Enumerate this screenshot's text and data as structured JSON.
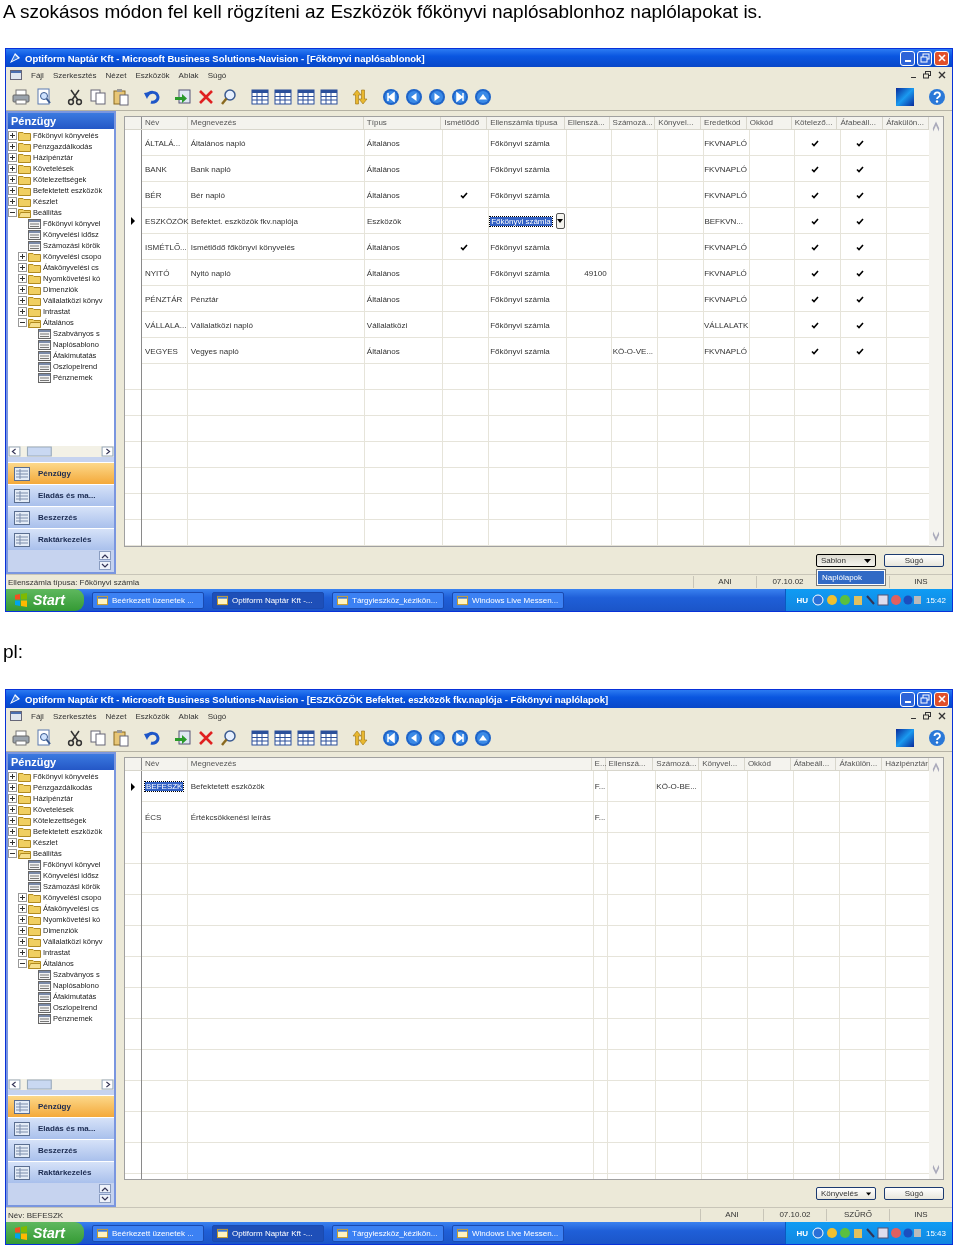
{
  "blocks": [
    {
      "kind": "text",
      "text": "A szokásos módon fel kell rögzíteni az Eszközök főkönyvi naplósablonhoz naplólapokat is."
    },
    {
      "kind": "screen",
      "window_title": "Optiform Naptár Kft - Microsoft Business Solutions-Navision - [Főkönyvi naplósablonok]",
      "menu": [
        "Fájl",
        "Szerkesztés",
        "Nézet",
        "Eszközök",
        "Ablak",
        "Súgó"
      ],
      "sidebar": {
        "title": "Pénzügy",
        "tree": [
          {
            "label": "Főkönyvi könyvelés",
            "kind": "folder",
            "expanded": false
          },
          {
            "label": "Pénzgazdálkodás",
            "kind": "folder",
            "expanded": false
          },
          {
            "label": "Házipénztár",
            "kind": "folder",
            "expanded": false
          },
          {
            "label": "Követelések",
            "kind": "folder",
            "expanded": false
          },
          {
            "label": "Kötelezettségek",
            "kind": "folder",
            "expanded": false
          },
          {
            "label": "Befektetett eszközök",
            "kind": "folder",
            "expanded": false
          },
          {
            "label": "Készlet",
            "kind": "folder",
            "expanded": false
          },
          {
            "label": "Beállítás",
            "kind": "folder",
            "expanded": true,
            "children": [
              {
                "label": "Főkönyvi könyvel",
                "kind": "form"
              },
              {
                "label": "Könyvelési idősz",
                "kind": "form"
              },
              {
                "label": "Számozási körök",
                "kind": "form"
              },
              {
                "label": "Könyvelési csopo",
                "kind": "folder",
                "expanded": false
              },
              {
                "label": "Áfakönyvelési cs",
                "kind": "folder",
                "expanded": false
              },
              {
                "label": "Nyomkövetési kó",
                "kind": "folder",
                "expanded": false
              },
              {
                "label": "Dimenziók",
                "kind": "folder",
                "expanded": false
              },
              {
                "label": "Vállalatközi könyv",
                "kind": "folder",
                "expanded": false
              },
              {
                "label": "Intrastat",
                "kind": "folder",
                "expanded": false
              },
              {
                "label": "Általános",
                "kind": "folder",
                "expanded": true,
                "children": [
                  {
                    "label": "Szabványos s",
                    "kind": "form"
                  },
                  {
                    "label": "Naplósablono",
                    "kind": "form"
                  },
                  {
                    "label": "Áfakimutatás",
                    "kind": "form"
                  },
                  {
                    "label": "Oszlopelrend",
                    "kind": "form"
                  },
                  {
                    "label": "Pénznemek",
                    "kind": "form"
                  }
                ]
              }
            ]
          }
        ],
        "nav_buttons": [
          {
            "label": "Pénzügy",
            "selected": true
          },
          {
            "label": "Eladás és ma...",
            "selected": false
          },
          {
            "label": "Beszerzés",
            "selected": false
          },
          {
            "label": "Raktárkezelés",
            "selected": false
          }
        ]
      },
      "grid": {
        "columns": [
          {
            "label": "Név",
            "kind": "text"
          },
          {
            "label": "Megnevezés",
            "kind": "text"
          },
          {
            "label": "Típus",
            "kind": "text"
          },
          {
            "label": "Ismétlődő",
            "kind": "check"
          },
          {
            "label": "Ellenszámla típusa",
            "kind": "text"
          },
          {
            "label": "Ellenszá...",
            "kind": "number"
          },
          {
            "label": "Számozá...",
            "kind": "text"
          },
          {
            "label": "Könyvel...",
            "kind": "text"
          },
          {
            "label": "Eredetkód",
            "kind": "text"
          },
          {
            "label": "Okkód",
            "kind": "text"
          },
          {
            "label": "Kötelező...",
            "kind": "check"
          },
          {
            "label": "Áfabeáll...",
            "kind": "check"
          },
          {
            "label": "Áfakülön...",
            "kind": "text"
          }
        ],
        "rows": [
          {
            "selected": false,
            "cells": [
              "ÁLTALÁ...",
              "Általános napló",
              "Általános",
              false,
              "Főkönyvi számla",
              null,
              null,
              null,
              "FKVNAPLÓ",
              null,
              true,
              true,
              null
            ]
          },
          {
            "selected": false,
            "cells": [
              "BANK",
              "Bank napló",
              "Általános",
              false,
              "Főkönyvi számla",
              null,
              null,
              null,
              "FKVNAPLÓ",
              null,
              true,
              true,
              null
            ]
          },
          {
            "selected": false,
            "cells": [
              "BÉR",
              "Bér napló",
              "Általános",
              true,
              "Főkönyvi számla",
              null,
              null,
              null,
              "FKVNAPLÓ",
              null,
              true,
              true,
              null
            ]
          },
          {
            "selected": true,
            "cells": [
              "ESZKÖZÖK",
              "Befektet. eszközök fkv.naplója",
              "Eszközök",
              false,
              {
                "text": "Főkönyvi számla",
                "selected": true,
                "dropdown": true
              },
              null,
              null,
              null,
              "BEFKVN...",
              null,
              true,
              true,
              null
            ]
          },
          {
            "selected": false,
            "cells": [
              "ISMÉTLŐ...",
              "Ismétlődő főkönyvi könyvelés",
              "Általános",
              true,
              "Főkönyvi számla",
              null,
              null,
              null,
              "FKVNAPLÓ",
              null,
              true,
              true,
              null
            ]
          },
          {
            "selected": false,
            "cells": [
              "NYITÓ",
              "Nyitó napló",
              "Általános",
              false,
              "Főkönyvi számla",
              "49100",
              null,
              null,
              "FKVNAPLÓ",
              null,
              true,
              true,
              null
            ]
          },
          {
            "selected": false,
            "cells": [
              "PÉNZTÁR",
              "Pénztár",
              "Általános",
              false,
              "Főkönyvi számla",
              null,
              null,
              null,
              "FKVNAPLÓ",
              null,
              true,
              true,
              null
            ]
          },
          {
            "selected": false,
            "cells": [
              "VÁLLALA...",
              "Vállalatközi napló",
              "Vállalatközi",
              false,
              "Főkönyvi számla",
              null,
              null,
              null,
              "VÁLLALATK",
              null,
              true,
              true,
              null
            ]
          },
          {
            "selected": false,
            "cells": [
              "VEGYES",
              "Vegyes napló",
              "Általános",
              false,
              "Főkönyvi számla",
              null,
              "KÖ-O-VE...",
              null,
              "FKVNAPLÓ",
              null,
              true,
              true,
              null
            ]
          }
        ]
      },
      "buttons": [
        {
          "label": "Sablon",
          "kind": "menu",
          "expanded": true,
          "menu_items": [
            {
              "label": "Naplólapok",
              "selected": true
            }
          ]
        },
        {
          "label": "Súgó",
          "kind": "plain"
        }
      ],
      "status_bar": {
        "text": "Ellenszámla típusa: Főkönyvi számla",
        "fields": [
          "ANI",
          "07.10.02",
          "INS"
        ]
      },
      "taskbar": {
        "start": "Start",
        "tasks": [
          {
            "label": "Beérkezett üzenetek ...",
            "selected": false
          },
          {
            "label": "Optiform Naptár Kft -...",
            "selected": true
          },
          {
            "label": "Tárgyieszköz_kézikön...",
            "selected": false
          },
          {
            "label": "Windows Live Messen...",
            "selected": false
          }
        ],
        "language": "HU",
        "clock": "15:42"
      }
    },
    {
      "kind": "text",
      "text": "pl:"
    },
    {
      "kind": "screen",
      "window_title": "Optiform Naptár Kft - Microsoft Business Solutions-Navision - [ESZKÖZÖK Befektet. eszközök fkv.naplója - Főkönyvi naplólapok]",
      "menu": [
        "Fájl",
        "Szerkesztés",
        "Nézet",
        "Eszközök",
        "Ablak",
        "Súgó"
      ],
      "sidebar": {
        "title": "Pénzügy",
        "tree": [
          {
            "label": "Főkönyvi könyvelés",
            "kind": "folder",
            "expanded": false
          },
          {
            "label": "Pénzgazdálkodás",
            "kind": "folder",
            "expanded": false
          },
          {
            "label": "Házipénztár",
            "kind": "folder",
            "expanded": false
          },
          {
            "label": "Követelések",
            "kind": "folder",
            "expanded": false
          },
          {
            "label": "Kötelezettségek",
            "kind": "folder",
            "expanded": false
          },
          {
            "label": "Befektetett eszközök",
            "kind": "folder",
            "expanded": false
          },
          {
            "label": "Készlet",
            "kind": "folder",
            "expanded": false
          },
          {
            "label": "Beállítás",
            "kind": "folder",
            "expanded": true,
            "children": [
              {
                "label": "Főkönyvi könyvel",
                "kind": "form"
              },
              {
                "label": "Könyvelési idősz",
                "kind": "form"
              },
              {
                "label": "Számozási körök",
                "kind": "form"
              },
              {
                "label": "Könyvelési csopo",
                "kind": "folder",
                "expanded": false
              },
              {
                "label": "Áfakönyvelési cs",
                "kind": "folder",
                "expanded": false
              },
              {
                "label": "Nyomkövetési kó",
                "kind": "folder",
                "expanded": false
              },
              {
                "label": "Dimenziók",
                "kind": "folder",
                "expanded": false
              },
              {
                "label": "Vállalatközi könyv",
                "kind": "folder",
                "expanded": false
              },
              {
                "label": "Intrastat",
                "kind": "folder",
                "expanded": false
              },
              {
                "label": "Általános",
                "kind": "folder",
                "expanded": true,
                "children": [
                  {
                    "label": "Szabványos s",
                    "kind": "form"
                  },
                  {
                    "label": "Naplósablono",
                    "kind": "form"
                  },
                  {
                    "label": "Áfakimutatás",
                    "kind": "form"
                  },
                  {
                    "label": "Oszlopelrend",
                    "kind": "form"
                  },
                  {
                    "label": "Pénznemek",
                    "kind": "form"
                  }
                ]
              }
            ]
          }
        ],
        "nav_buttons": [
          {
            "label": "Pénzügy",
            "selected": true
          },
          {
            "label": "Eladás és ma...",
            "selected": false
          },
          {
            "label": "Beszerzés",
            "selected": false
          },
          {
            "label": "Raktárkezelés",
            "selected": false
          }
        ]
      },
      "grid": {
        "columns": [
          {
            "label": "Név",
            "kind": "text"
          },
          {
            "label": "Megnevezés",
            "kind": "text"
          },
          {
            "label": "E...",
            "kind": "text"
          },
          {
            "label": "Ellenszá...",
            "kind": "text"
          },
          {
            "label": "Számozá...",
            "kind": "text"
          },
          {
            "label": "Könyvel...",
            "kind": "text"
          },
          {
            "label": "Okkód",
            "kind": "text"
          },
          {
            "label": "Áfabeáll...",
            "kind": "text"
          },
          {
            "label": "Áfakülön...",
            "kind": "text"
          },
          {
            "label": "Házipénztár",
            "kind": "text"
          }
        ],
        "rows": [
          {
            "selected": true,
            "cells": [
              {
                "text": "BEFESZK",
                "selected": true,
                "dropdown": false
              },
              "Befektetett eszközök",
              "F...",
              null,
              "KÖ-O-BE...",
              null,
              null,
              null,
              null,
              null
            ]
          },
          {
            "selected": false,
            "cells": [
              "ÉCS",
              "Értékcsökkenési leírás",
              "F...",
              null,
              null,
              null,
              null,
              null,
              null,
              null
            ]
          }
        ]
      },
      "buttons": [
        {
          "label": "Könyvelés",
          "kind": "menu",
          "expanded": false
        },
        {
          "label": "Súgó",
          "kind": "plain"
        }
      ],
      "status_bar": {
        "text": "Név: BEFESZK",
        "fields": [
          "ANI",
          "07.10.02",
          "SZŰRŐ",
          "INS"
        ]
      },
      "taskbar": {
        "start": "Start",
        "tasks": [
          {
            "label": "Beérkezett üzenetek ...",
            "selected": false
          },
          {
            "label": "Optiform Naptár Kft -...",
            "selected": true
          },
          {
            "label": "Tárgyieszköz_kézikön...",
            "selected": false
          },
          {
            "label": "Windows Live Messen...",
            "selected": false
          }
        ],
        "language": "HU",
        "clock": "15:43"
      }
    }
  ]
}
